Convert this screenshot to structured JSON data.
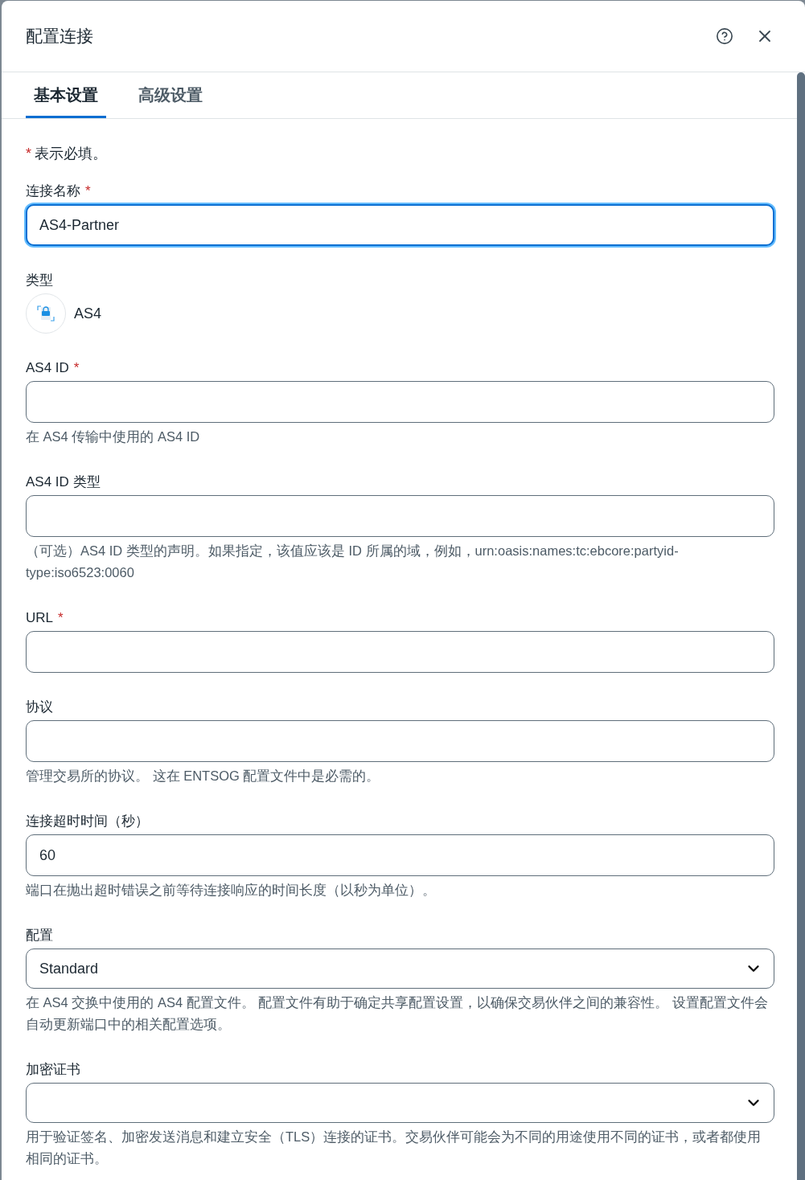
{
  "dialog": {
    "title": "配置连接"
  },
  "tabs": [
    {
      "label": "基本设置",
      "selected": true
    },
    {
      "label": "高级设置",
      "selected": false
    }
  ],
  "required_note": {
    "mark": "*",
    "text": "表示必填。"
  },
  "fields": [
    {
      "kind": "text",
      "label": "连接名称",
      "required_mark": "*",
      "value": "AS4-Partner",
      "focused": true
    },
    {
      "kind": "type",
      "label": "类型",
      "value": "AS4"
    },
    {
      "kind": "text",
      "label": "AS4 ID",
      "required_mark": "*",
      "focused": false,
      "hint": "在 AS4 传输中使用的 AS4 ID"
    },
    {
      "kind": "text",
      "label": "AS4 ID 类型",
      "focused": false,
      "hint": "（可选）AS4 ID 类型的声明。如果指定，该值应该是 ID 所属的域，例如，urn:oasis:names:tc:ebcore:partyid-type:iso6523:0060"
    },
    {
      "kind": "text",
      "label": "URL",
      "required_mark": "*",
      "focused": false
    },
    {
      "kind": "text",
      "label": "协议",
      "focused": false,
      "hint": "管理交易所的协议。 这在 ENTSOG 配置文件中是必需的。"
    },
    {
      "kind": "text",
      "label": "连接超时时间（秒）",
      "focused": false,
      "value": "60",
      "hint": "端口在抛出超时错误之前等待连接响应的时间长度（以秒为单位）。"
    },
    {
      "kind": "select",
      "label": "配置",
      "focused": false,
      "value": "Standard",
      "hint": "在 AS4 交换中使用的 AS4 配置文件。 配置文件有助于确定共享配置设置，以确保交易伙伴之间的兼容性。 设置配置文件会自动更新端口中的相关配置选项。"
    },
    {
      "kind": "select",
      "label": "加密证书",
      "focused": false,
      "hint": "用于验证签名、加密发送消息和建立安全（TLS）连接的证书。交易伙伴可能会为不同的用途使用不同的证书，或者都使用相同的证书。"
    }
  ]
}
